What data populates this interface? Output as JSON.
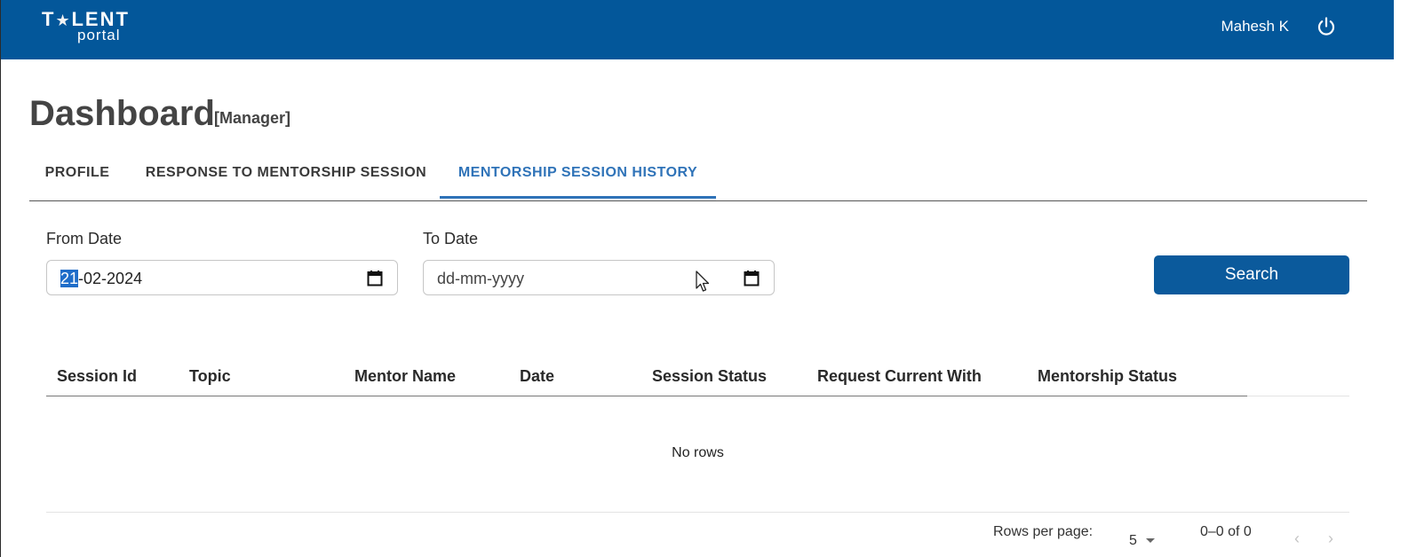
{
  "header": {
    "logo_top_left": "T",
    "logo_top_right": "LENT",
    "logo_bottom": "portal",
    "user_name": "Mahesh K",
    "power_icon": "power-icon",
    "bg_color": "#03579a"
  },
  "page": {
    "title": "Dashboard",
    "role": "[Manager]"
  },
  "tabs": [
    {
      "label": "PROFILE",
      "active": false
    },
    {
      "label": "RESPONSE TO MENTORSHIP SESSION",
      "active": false
    },
    {
      "label": "MENTORSHIP SESSION HISTORY",
      "active": true
    }
  ],
  "filters": {
    "from_label": "From Date",
    "from_value_selected": "21",
    "from_value_rest": "-02-2024",
    "to_label": "To Date",
    "to_placeholder": "dd-mm-yyyy",
    "calendar_icon": "calendar-icon",
    "search_label": "Search"
  },
  "table": {
    "columns": [
      "Session Id",
      "Topic",
      "Mentor Name",
      "Date",
      "Session Status",
      "Request Current With",
      "Mentorship Status"
    ],
    "empty_text": "No rows"
  },
  "pagination": {
    "rows_per_page_label": "Rows per page:",
    "rows_per_page_value": "5",
    "range_text": "0–0 of 0",
    "prev_glyph": "‹",
    "next_glyph": "›"
  },
  "colors": {
    "accent": "#2f73b8",
    "button": "#0b5a9c"
  }
}
